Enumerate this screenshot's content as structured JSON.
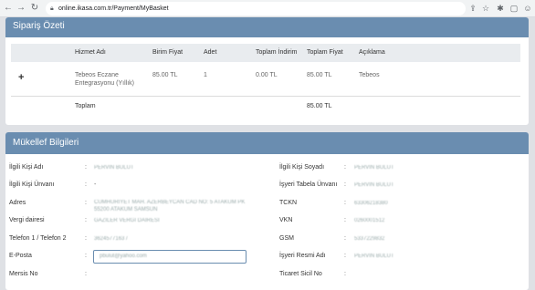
{
  "browser": {
    "url": "online.ikasa.com.tr/Payment/MyBasket"
  },
  "summary": {
    "title": "Sipariş Özeti",
    "columns": [
      "Hizmet Adı",
      "Birim Fiyat",
      "Adet",
      "Toplam İndirim",
      "Toplam Fiyat",
      "Açıklama"
    ],
    "rows": [
      {
        "service_line1": "Tebeos Eczane",
        "service_line2": "Entegrasyonu (Yıllık)",
        "unit_price": "85.00 TL",
        "quantity": "1",
        "discount": "0.00 TL",
        "total": "85.00 TL",
        "description": "Tebeos"
      }
    ],
    "footer_label": "Toplam",
    "footer_total": "85.00 TL"
  },
  "taxpayer": {
    "title": "Mükellef Bilgileri",
    "left": [
      {
        "label": "İlgili Kişi Adı",
        "value": "PERVIN BULUT"
      },
      {
        "label": "İlgili Kişi Ünvanı",
        "value": "-"
      },
      {
        "label": "Adres",
        "value": "CUMHURIYET MAH. AZERBEYCAN CAD NO: 5 ATAKUM PK 55200 ATAKUM SAMSUN"
      },
      {
        "label": "Vergi dairesi",
        "value": "GAZILER VERGI DAIRESI"
      },
      {
        "label": "Telefon 1 / Telefon 2",
        "value": "3624577163 /"
      },
      {
        "label": "E-Posta",
        "value": "pbulut@yahoo.com"
      },
      {
        "label": "Mersis No",
        "value": ""
      }
    ],
    "right": [
      {
        "label": "İlgili Kişi Soyadı",
        "value": "PERVIN BULUT"
      },
      {
        "label": "İşyeri Tabela Ünvanı",
        "value": "PERVIN BULUT"
      },
      {
        "label": "TCKN",
        "value": "63306218380"
      },
      {
        "label": "VKN",
        "value": "0260001512"
      },
      {
        "label": "GSM",
        "value": "5337229832"
      },
      {
        "label": "İşyeri Resmi Adı",
        "value": "PERVIN BULUT"
      },
      {
        "label": "Ticaret Sicil No",
        "value": ""
      }
    ]
  }
}
